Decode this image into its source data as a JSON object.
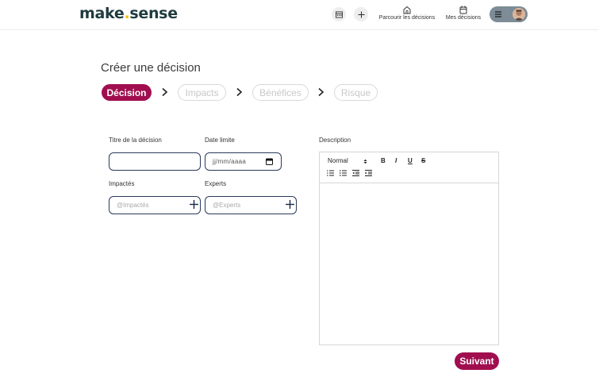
{
  "header": {
    "logo_left": "make",
    "logo_dot": ".",
    "logo_right": "sense",
    "nav_browse": "Parcourir les décisions",
    "nav_my": "Mes décisions",
    "new_icon": "plus-icon",
    "calendar_icon": "calendar-icon"
  },
  "page": {
    "title": "Créer une décision"
  },
  "steps": [
    {
      "label": "Décision",
      "active": true
    },
    {
      "label": "Impacts",
      "active": false
    },
    {
      "label": "Bénéfices",
      "active": false
    },
    {
      "label": "Risque",
      "active": false
    }
  ],
  "form": {
    "title_label": "Titre de la décision",
    "title_value": "",
    "deadline_label": "Date limite",
    "deadline_placeholder": "jj/mm/aaaa",
    "impacted_label": "Impactés",
    "impacted_placeholder": "@Impactés",
    "experts_label": "Experts",
    "experts_placeholder": "@Experts",
    "description_label": "Description"
  },
  "editor": {
    "format_select": "Normal",
    "bold": "B",
    "italic": "I",
    "underline": "U",
    "strike": "S"
  },
  "actions": {
    "next_label": "Suivant"
  },
  "colors": {
    "accent": "#a10e4f",
    "logo": "#1f3b3f",
    "logo_dot": "#f2c200",
    "input_border": "#2a3a5c"
  }
}
